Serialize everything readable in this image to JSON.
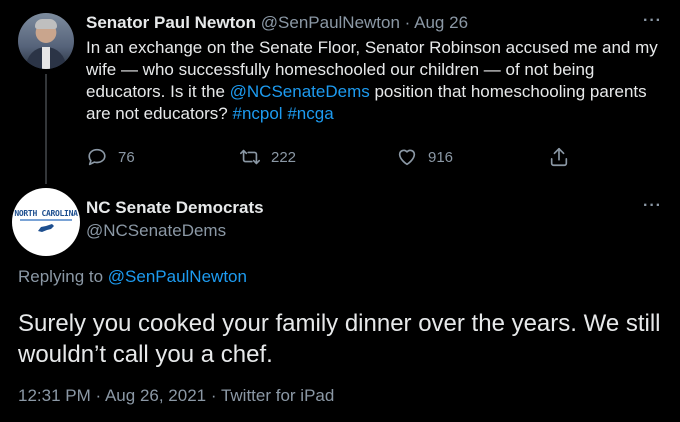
{
  "tweet1": {
    "author_name": "Senator Paul Newton",
    "handle": "@SenPaulNewton",
    "separator": "·",
    "date": "Aug 26",
    "text_before": "In an exchange on the Senate Floor, Senator Robinson accused me and my wife — who successfully homeschooled our children — of not being educators. Is it the ",
    "mention": "@NCSenateDems",
    "text_after": " position that homeschooling parents are not educators? ",
    "hashtag1": "#ncpol",
    "hashtag2": "#ncga",
    "replies": "76",
    "retweets": "222",
    "likes": "916",
    "more": "···"
  },
  "tweet2": {
    "author_name": "NC Senate Democrats",
    "handle": "@NCSenateDems",
    "avatar_text": "NORTH CAROLINA",
    "more": "···",
    "replying_label": "Replying to ",
    "replying_handle": "@SenPaulNewton",
    "text": "Surely you cooked your family dinner over the years. We still wouldn’t call you a chef.",
    "time": "12:31 PM",
    "separator": "·",
    "date": "Aug 26, 2021",
    "source": "Twitter for iPad"
  },
  "colors": {
    "background": "#000000",
    "primary_text": "#e7e9ea",
    "secondary_text": "#8b98a5",
    "link": "#1d9bf0"
  },
  "icons": [
    "reply-icon",
    "retweet-icon",
    "like-icon",
    "share-icon",
    "more-icon"
  ]
}
